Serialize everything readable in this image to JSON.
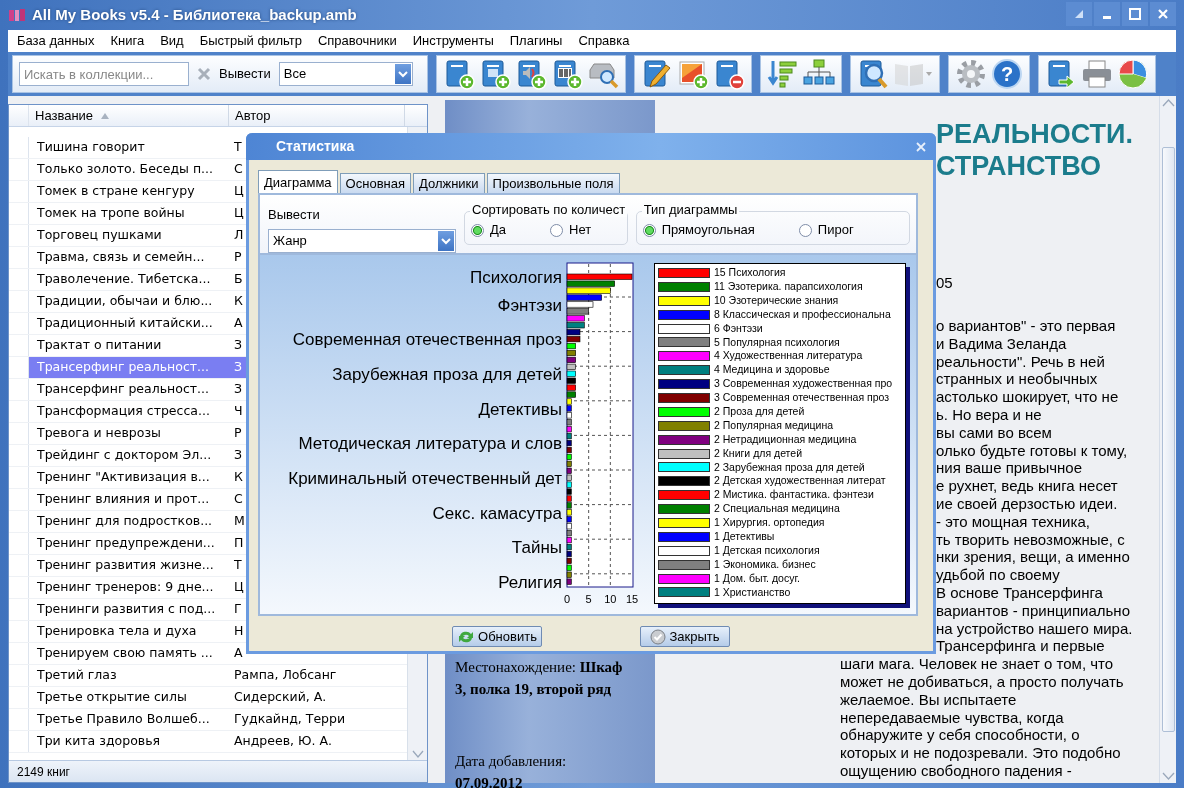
{
  "window": {
    "title": "All My Books v5.4 - Библиотека_backup.amb"
  },
  "menu": [
    {
      "label": "База данных"
    },
    {
      "label": "Книга"
    },
    {
      "label": "Вид"
    },
    {
      "label": "Быстрый фильтр"
    },
    {
      "label": "Справочники"
    },
    {
      "label": "Инструменты"
    },
    {
      "label": "Плагины"
    },
    {
      "label": "Справка"
    }
  ],
  "toolbar": {
    "search": {
      "placeholder": "Искать в коллекции..."
    },
    "filter_label": "Вывести",
    "filter_value": "Все",
    "groups": [
      {
        "buttons": [
          {
            "kind": "add-book",
            "disabled": false
          },
          {
            "kind": "add-ebook",
            "disabled": false
          },
          {
            "kind": "add-audio",
            "disabled": false
          },
          {
            "kind": "add-barcode",
            "disabled": false
          },
          {
            "kind": "scan",
            "disabled": false
          }
        ]
      },
      {
        "buttons": [
          {
            "kind": "edit",
            "disabled": false
          },
          {
            "kind": "add-picture",
            "disabled": false
          },
          {
            "kind": "delete",
            "disabled": false
          }
        ]
      },
      {
        "buttons": [
          {
            "kind": "sort",
            "disabled": false
          },
          {
            "kind": "tree",
            "disabled": false
          }
        ]
      },
      {
        "buttons": [
          {
            "kind": "search",
            "disabled": false
          },
          {
            "kind": "open-book",
            "disabled": true
          }
        ]
      },
      {
        "buttons": [
          {
            "kind": "settings",
            "disabled": false
          },
          {
            "kind": "help",
            "glyph": "?",
            "disabled": false
          }
        ]
      },
      {
        "buttons": [
          {
            "kind": "export",
            "disabled": false
          },
          {
            "kind": "print",
            "disabled": false
          },
          {
            "kind": "chart",
            "disabled": false
          }
        ]
      }
    ]
  },
  "list": {
    "columns": [
      {
        "label": "Название",
        "sorted": true
      },
      {
        "label": "Автор",
        "sorted": false
      }
    ],
    "rows": [
      {
        "title": "Тишина говорит",
        "author": "Т",
        "selected": false
      },
      {
        "title": "Только золото. Беседы п...",
        "author": "С",
        "selected": false
      },
      {
        "title": "Томек в стране кенгуру",
        "author": "Ц",
        "selected": false
      },
      {
        "title": "Томек на тропе войны",
        "author": "Ц",
        "selected": false
      },
      {
        "title": "Торговец пушками",
        "author": "Л",
        "selected": false
      },
      {
        "title": "Травма, связь и семейн...",
        "author": "Р",
        "selected": false
      },
      {
        "title": "Траволечение. Тибетска...",
        "author": "Б",
        "selected": false
      },
      {
        "title": "Традиции, обычаи и блю...",
        "author": "К",
        "selected": false
      },
      {
        "title": "Традиционный китайски...",
        "author": "А",
        "selected": false
      },
      {
        "title": "Трактат о питании",
        "author": "З",
        "selected": false
      },
      {
        "title": "Трансерфинг реальност...",
        "author": "З",
        "selected": true
      },
      {
        "title": "Трансерфинг реальност...",
        "author": "З",
        "selected": false
      },
      {
        "title": "Трансформация стресса...",
        "author": "Ч",
        "selected": false
      },
      {
        "title": "Тревога и неврозы",
        "author": "Р",
        "selected": false
      },
      {
        "title": "Трейдинг с доктором Эл...",
        "author": "З",
        "selected": false
      },
      {
        "title": "Тренинг \"Активизация в...",
        "author": "К",
        "selected": false
      },
      {
        "title": "Тренинг влияния и прот...",
        "author": "С",
        "selected": false
      },
      {
        "title": "Тренинг для подростков...",
        "author": "М",
        "selected": false
      },
      {
        "title": "Тренинг предупреждени...",
        "author": "П",
        "selected": false
      },
      {
        "title": "Тренинг развития жизне...",
        "author": "Т",
        "selected": false
      },
      {
        "title": "Тренинг тренеров: 9 дне...",
        "author": "Ц",
        "selected": false
      },
      {
        "title": "Тренинги развития с под...",
        "author": "Г",
        "selected": false
      },
      {
        "title": "Тренировка тела и духа",
        "author": "Н",
        "selected": false
      },
      {
        "title": "Тренируем свою память ...",
        "author": "А",
        "selected": false
      },
      {
        "title": "Третий глаз",
        "author": "Рампа, Лобсанг",
        "selected": false
      },
      {
        "title": "Третье открытие силы",
        "author": "Сидерский, А.",
        "selected": false
      },
      {
        "title": "Третье Правило Волшеб...",
        "author": "Гудкайнд, Терри",
        "selected": false
      },
      {
        "title": "Три кита здоровья",
        "author": "Андреев, Ю. А.",
        "selected": false
      }
    ],
    "status": "2149 книг"
  },
  "book": {
    "location_lines": [
      {
        "text": "Местонахождение: **Шкаф**",
        "bold": false
      },
      {
        "text": "3, полка 19, второй ряд",
        "bold": true
      }
    ],
    "date_label": "Дата добавления:",
    "date": "07.09.2012"
  },
  "details": {
    "heading_fragments": [
      "РЕАЛЬНОСТИ.",
      "СТРАНСТВО"
    ],
    "year": "05",
    "line_fragments": [
      "о вариантов\" - это первая",
      "и Вадима Зеланда",
      "реальности\". Речь в ней",
      "странных и необычных",
      "астолько шокирует, что не",
      "ь. Но вера и не",
      "вы сами во всем",
      "олько будьте готовы к тому,",
      "ния ваше привычное",
      "е рухнет, ведь книга несет",
      "ие своей дерзостью идеи.",
      "- это мощная техника,",
      "ть творить невозможные, с",
      "нки зрения, вещи, а именно",
      "удьбой по своему",
      "В основе Трансерфинга",
      "вариантов - принципиально",
      "на устройство нашего мира.",
      "Трансерфинга и первые"
    ],
    "lines": [
      "шаги мага. Человек не знает о том, что",
      "может не добиваться, а просто получать",
      "желаемое. Вы испытаете",
      "непередаваемые чувства, когда",
      "обнаружите у себя способности, о",
      "которых и не подозревали. Это подобно",
      "ощущению свободного падения -"
    ]
  },
  "dialog": {
    "title": "Статистика",
    "tabs": [
      {
        "label": "Диаграмма",
        "selected": true
      },
      {
        "label": "Основная",
        "selected": false
      },
      {
        "label": "Должники",
        "selected": false
      },
      {
        "label": "Произвольные поля",
        "selected": false
      }
    ],
    "output_label": "Вывести",
    "output_value": "Жанр",
    "sort_group": {
      "title": "Сортировать по количест",
      "options": [
        {
          "label": "Да",
          "selected": true
        },
        {
          "label": "Нет",
          "selected": false
        }
      ]
    },
    "type_group": {
      "title": "Тип диаграммы",
      "options": [
        {
          "label": "Прямоугольная",
          "selected": true
        },
        {
          "label": "Пирог",
          "selected": false
        }
      ]
    },
    "chart_data": {
      "type": "bar",
      "orientation": "horizontal",
      "grid": true,
      "categories": [
        "Психология",
        null,
        null,
        null,
        "Фэнтэзи",
        null,
        null,
        null,
        null,
        "Современная отечественная проз",
        null,
        null,
        null,
        null,
        "Зарубежная проза для детей",
        null,
        null,
        null,
        null,
        "Детективы",
        null,
        null,
        null,
        null,
        "Методическая литература и слов",
        null,
        null,
        null,
        null,
        "Криминальный отечественный дет",
        null,
        null,
        null,
        null,
        "Секс. камасутра",
        null,
        null,
        null,
        null,
        "Тайны",
        null,
        null,
        null,
        null,
        "Религия"
      ],
      "values": [
        15,
        11,
        10,
        8,
        6,
        5,
        4,
        4,
        3,
        3,
        2,
        2,
        2,
        2,
        2,
        2,
        2,
        2,
        1,
        1,
        1,
        1,
        1,
        1,
        1,
        1,
        1,
        1,
        1,
        1,
        1,
        1,
        1,
        1,
        1,
        1,
        1,
        1,
        1,
        1,
        1,
        1,
        1,
        1,
        1
      ],
      "xlim": [
        0,
        15
      ],
      "xticks": [
        0,
        5,
        10,
        15
      ]
    },
    "legend": [
      {
        "label": "15 Психология",
        "color": "#ff0000"
      },
      {
        "label": "11 Эзотерика. парапсихология",
        "color": "#008000"
      },
      {
        "label": "10 Эзотерические знания",
        "color": "#ffff00"
      },
      {
        "label": "8 Классическая и профессиональна",
        "color": "#0000ff"
      },
      {
        "label": "6 Фэнтэзи",
        "color": "#ffffff"
      },
      {
        "label": "5 Популярная психология",
        "color": "#808080"
      },
      {
        "label": "4 Художественная литература",
        "color": "#ff00ff"
      },
      {
        "label": "4 Медицина и здоровье",
        "color": "#008080"
      },
      {
        "label": "3 Современная художественная про",
        "color": "#000080"
      },
      {
        "label": "3 Современная отечественная проз",
        "color": "#800000"
      },
      {
        "label": "2 Проза для детей",
        "color": "#00ff00"
      },
      {
        "label": "2 Популярная медицина",
        "color": "#808000"
      },
      {
        "label": "2 Нетрадиционная медицина",
        "color": "#800080"
      },
      {
        "label": "2 Книги для детей",
        "color": "#c0c0c0"
      },
      {
        "label": "2 Зарубежная проза для детей",
        "color": "#00ffff"
      },
      {
        "label": "2 Детская художественная литерат",
        "color": "#000000"
      },
      {
        "label": "2 Мистика. фантастика. фэнтези",
        "color": "#ff0000"
      },
      {
        "label": "2 Специальная медицина",
        "color": "#008000"
      },
      {
        "label": "1 Хирургия. ортопедия",
        "color": "#ffff00"
      },
      {
        "label": "1 Детективы",
        "color": "#0000ff"
      },
      {
        "label": "1 Детская психология",
        "color": "#ffffff"
      },
      {
        "label": "1 Экономика. бизнес",
        "color": "#808080"
      },
      {
        "label": "1 Дом. быт. досуг.",
        "color": "#ff00ff"
      },
      {
        "label": "1 Христианство",
        "color": "#008080"
      }
    ],
    "buttons": [
      {
        "kind": "refresh",
        "label": "Обновить"
      },
      {
        "kind": "close",
        "label": "Закрыть"
      }
    ]
  }
}
